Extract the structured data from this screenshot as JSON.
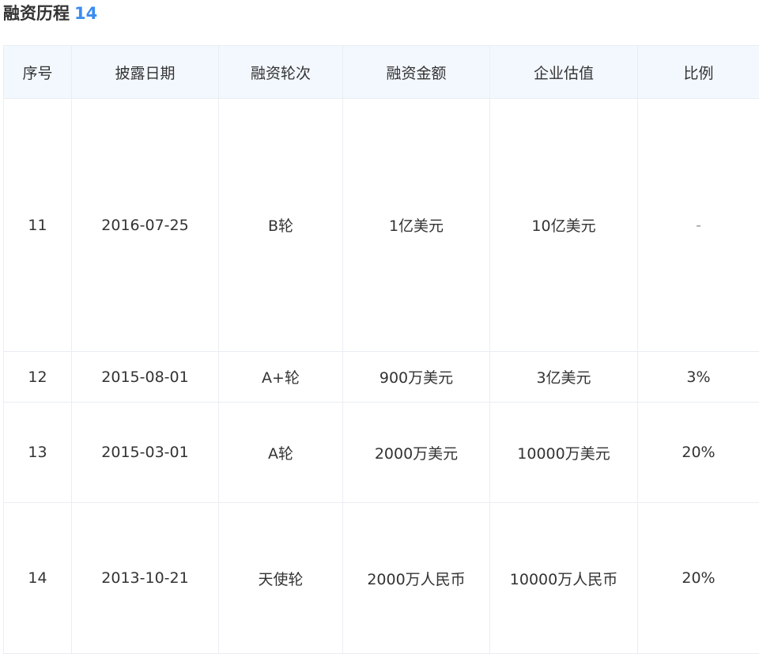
{
  "section": {
    "title": "融资历程",
    "count": "14"
  },
  "table": {
    "headers": [
      "序号",
      "披露日期",
      "融资轮次",
      "融资金额",
      "企业估值",
      "比例"
    ],
    "rows": [
      [
        "11",
        "2016-07-25",
        "B轮",
        "1亿美元",
        "10亿美元",
        "-"
      ],
      [
        "12",
        "2015-08-01",
        "A+轮",
        "900万美元",
        "3亿美元",
        "3%"
      ],
      [
        "13",
        "2015-03-01",
        "A轮",
        "2000万美元",
        "10000万美元",
        "20%"
      ],
      [
        "14",
        "2013-10-21",
        "天使轮",
        "2000万人民币",
        "10000万人民币",
        "20%"
      ]
    ]
  }
}
